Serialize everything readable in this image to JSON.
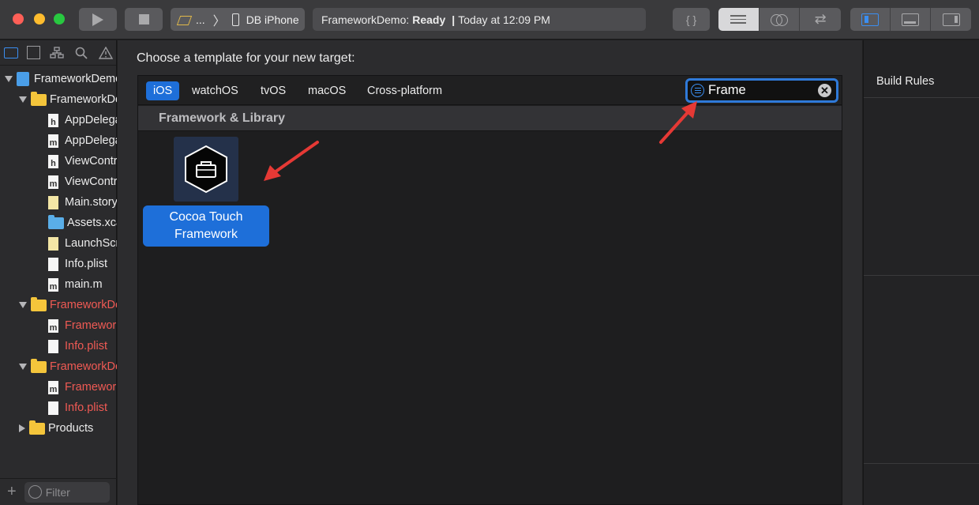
{
  "toolbar": {
    "scheme_dots": "...",
    "scheme_separator": "〉",
    "device": "DB iPhone",
    "status_project": "FrameworkDemo:",
    "status_state": "Ready",
    "status_separator": "|",
    "status_time": "Today at 12:09 PM",
    "code_button": "{ }",
    "swap_glyph": "⇄"
  },
  "navigator": {
    "tree": [
      {
        "label": "FrameworkDemo",
        "kind": "project",
        "disclosure": "open"
      },
      {
        "label": "FrameworkDemo",
        "kind": "folder",
        "disclosure": "open"
      },
      {
        "label": "AppDelegate.h",
        "kind": "file",
        "glyph": "h"
      },
      {
        "label": "AppDelegate.m",
        "kind": "file",
        "glyph": "m"
      },
      {
        "label": "ViewController.h",
        "kind": "file",
        "glyph": "h"
      },
      {
        "label": "ViewController.m",
        "kind": "file",
        "glyph": "m"
      },
      {
        "label": "Main.storyboard",
        "kind": "storyboard",
        "glyph": ""
      },
      {
        "label": "Assets.xcassets",
        "kind": "assets",
        "glyph": ""
      },
      {
        "label": "LaunchScreen.storyboard",
        "kind": "storyboard",
        "glyph": ""
      },
      {
        "label": "Info.plist",
        "kind": "file",
        "glyph": ""
      },
      {
        "label": "main.m",
        "kind": "file",
        "glyph": "m"
      },
      {
        "label": "FrameworkDemoTests",
        "kind": "folder",
        "disclosure": "open",
        "red": true
      },
      {
        "label": "FrameworkDemoTests.m",
        "kind": "file",
        "glyph": "m",
        "red": true
      },
      {
        "label": "Info.plist",
        "kind": "file",
        "glyph": "",
        "red": true
      },
      {
        "label": "FrameworkDemoUITests",
        "kind": "folder",
        "disclosure": "open",
        "red": true
      },
      {
        "label": "FrameworkDemoUITests.m",
        "kind": "file",
        "glyph": "m",
        "red": true
      },
      {
        "label": "Info.plist",
        "kind": "file",
        "glyph": "",
        "red": true
      },
      {
        "label": "Products",
        "kind": "folder",
        "disclosure": "closed"
      }
    ],
    "filter_placeholder": "Filter",
    "add_glyph": "+"
  },
  "dialog": {
    "prompt": "Choose a template for your new target:",
    "platforms": [
      "iOS",
      "watchOS",
      "tvOS",
      "macOS",
      "Cross-platform"
    ],
    "selected_platform": "iOS",
    "search_value": "Frame",
    "clear_glyph": "✕",
    "section_title": "Framework & Library",
    "template_line1": "Cocoa Touch",
    "template_line2": "Framework"
  },
  "inspector": {
    "tab_label": "Build Rules"
  },
  "colors": {
    "accent": "#1e6fd9",
    "annotation_arrow": "#e53935",
    "missing_file_red": "#f05a54"
  }
}
